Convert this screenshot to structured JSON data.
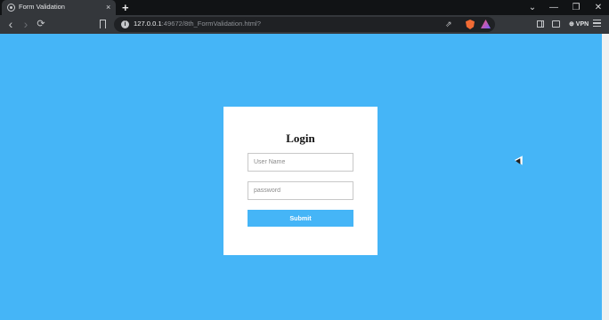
{
  "browser": {
    "tab": {
      "title": "Form Validation",
      "favicon": "globe-icon",
      "close": "×"
    },
    "new_tab": "+",
    "window_controls": {
      "tab_search": "⌄",
      "minimize": "—",
      "restore": "❐",
      "close": "✕"
    },
    "nav": {
      "back": "‹",
      "forward": "›",
      "reload": "⟳"
    },
    "omnibox": {
      "info_icon": "i",
      "url_host": "127.0.0.1",
      "url_rest": ":49672/8th_FormValidation.html?"
    },
    "extensions": {
      "vpn_label": "⊕ VPN"
    }
  },
  "page": {
    "background": "#45b5f7",
    "card": {
      "title": "Login",
      "username_placeholder": "User Name",
      "password_placeholder": "password",
      "submit_label": "Submit"
    }
  }
}
